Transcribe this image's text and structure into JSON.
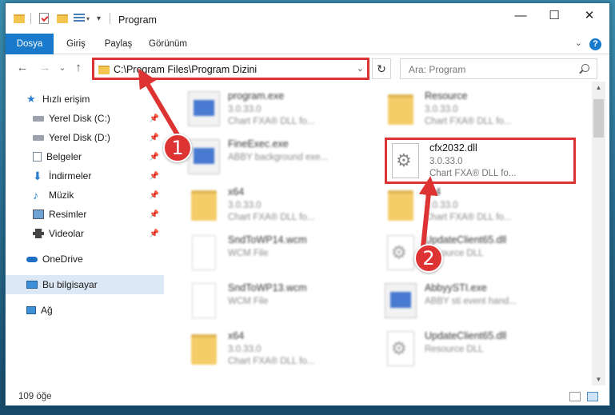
{
  "window": {
    "title": "Program",
    "controls": {
      "minimize": "—",
      "maximize": "☐",
      "close": "✕"
    }
  },
  "ribbon": {
    "tabs": [
      "Dosya",
      "Giriş",
      "Paylaş",
      "Görünüm"
    ],
    "expand_icon": "chevron-down-icon",
    "help": "?"
  },
  "navbar": {
    "back": "←",
    "forward": "→",
    "history": "⌄",
    "up": "↑",
    "address": "C:\\Program Files\\Program Dizini",
    "refresh": "↻",
    "search_placeholder": "Ara: Program"
  },
  "sidebar": {
    "items": [
      {
        "label": "Hızlı erişim",
        "icon": "star-icon",
        "pinned": false
      },
      {
        "label": "Yerel Disk (C:)",
        "icon": "drive-icon",
        "pinned": true
      },
      {
        "label": "Yerel Disk (D:)",
        "icon": "drive-icon",
        "pinned": true
      },
      {
        "label": "Belgeler",
        "icon": "documents-icon",
        "pinned": true
      },
      {
        "label": "İndirmeler",
        "icon": "download-icon",
        "pinned": true
      },
      {
        "label": "Müzik",
        "icon": "music-icon",
        "pinned": true
      },
      {
        "label": "Resimler",
        "icon": "pictures-icon",
        "pinned": true
      },
      {
        "label": "Videolar",
        "icon": "video-icon",
        "pinned": true
      },
      {
        "label": "OneDrive",
        "icon": "cloud-icon",
        "pinned": false
      },
      {
        "label": "Bu bilgisayar",
        "icon": "computer-icon",
        "pinned": false,
        "selected": true
      },
      {
        "label": "Ağ",
        "icon": "network-icon",
        "pinned": false
      }
    ]
  },
  "files": {
    "left": [
      {
        "name": "program.exe",
        "version": "3.0.33.0",
        "desc": "Chart FXA® DLL fo...",
        "kind": "exe"
      },
      {
        "name": "FineExec.exe",
        "version": "",
        "desc": "ABBY background exe...",
        "kind": "exe"
      },
      {
        "name": "x64",
        "version": "3.0.33.0",
        "desc": "Chart FXA® DLL fo...",
        "kind": "folder"
      },
      {
        "name": "SndToWP14.wcm",
        "version": "WCM File",
        "desc": "",
        "kind": "file"
      },
      {
        "name": "SndToWP13.wcm",
        "version": "WCM File",
        "desc": "",
        "kind": "file"
      },
      {
        "name": "x64",
        "version": "3.0.33.0",
        "desc": "Chart FXA® DLL fo...",
        "kind": "folder"
      }
    ],
    "right": [
      {
        "name": "Resource",
        "version": "3.0.33.0",
        "desc": "Chart FXA® DLL fo...",
        "kind": "folder"
      },
      {
        "name": "cfx2032.dll",
        "version": "3.0.33.0",
        "desc": "Chart FXA® DLL fo...",
        "kind": "dll",
        "highlighted": true
      },
      {
        "name": "x64",
        "version": "3.0.33.0",
        "desc": "Chart FXA® DLL fo...",
        "kind": "folder"
      },
      {
        "name": "UpdateClient65.dll",
        "version": "Resource DLL",
        "desc": "",
        "kind": "dll"
      },
      {
        "name": "AbbyySTI.exe",
        "version": "ABBY sti event hand...",
        "desc": "",
        "kind": "exe"
      },
      {
        "name": "UpdateClient65.dll",
        "version": "Resource DLL",
        "desc": "",
        "kind": "dll"
      }
    ]
  },
  "status": {
    "item_count": "109 öğe"
  },
  "annotations": {
    "callout_1": "1",
    "callout_2": "2",
    "color": "#dd3333"
  },
  "colors": {
    "accent": "#1979ca",
    "selection": "#dce8f5",
    "annotation": "#dd3333"
  }
}
